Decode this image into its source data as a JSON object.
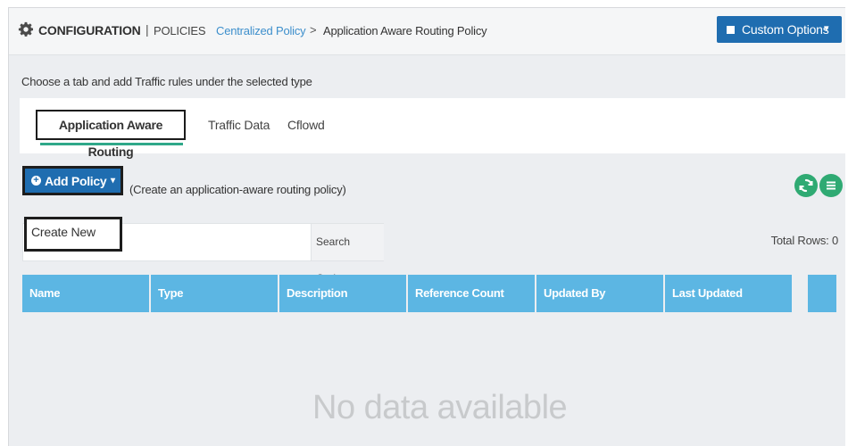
{
  "header": {
    "section": "CONFIGURATION",
    "separator": "|",
    "subsection": "POLICIES",
    "breadcrumb_parent": "Centralized Policy",
    "breadcrumb_arrow": ">",
    "breadcrumb_current": "Application Aware Routing Policy",
    "custom_options_label": "Custom Options",
    "custom_options_caret": "▾"
  },
  "instruction": "Choose a tab and add Traffic rules under the selected type",
  "tabs": [
    {
      "label": "Application Aware Routing",
      "active": true
    },
    {
      "label": "Traffic Data",
      "active": false
    },
    {
      "label": "Cflowd",
      "active": false
    }
  ],
  "toolbar": {
    "add_policy_label": "Add Policy",
    "add_policy_caret": "▾",
    "add_policy_hint": "(Create an application-aware routing policy)",
    "dropdown_item": "Create New",
    "search_options_label": "Search Options",
    "search_options_caret": "⌄",
    "total_rows": "Total Rows: 0"
  },
  "table": {
    "columns": [
      "Name",
      "Type",
      "Description",
      "Reference Count",
      "Updated By",
      "Last Updated",
      ""
    ],
    "empty_message": "No data available"
  },
  "colors": {
    "primary_button": "#1f6db0",
    "table_header": "#5cb6e3",
    "tab_underline": "#2fa889",
    "round_buttons": "#2faa73",
    "breadcrumb_link": "#3d8fcc"
  },
  "icons": [
    "gear-icon",
    "plus-circle-icon",
    "refresh-icon",
    "menu-icon",
    "square-icon"
  ]
}
